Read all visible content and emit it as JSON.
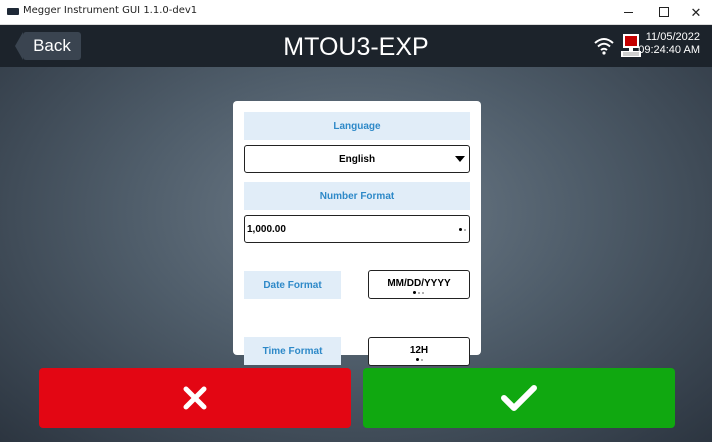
{
  "window": {
    "title": "Megger Instrument GUI 1.1.0-dev1",
    "controls": [
      "minimize",
      "maximize",
      "close"
    ]
  },
  "header": {
    "back_label": "Back",
    "title": "MTOU3-EXP",
    "date": "11/05/2022",
    "time": "09:24:40 AM",
    "icons": [
      "wifi-icon",
      "device-status-icon"
    ]
  },
  "settings": {
    "language_label": "Language",
    "language_value": "English",
    "number_format_label": "Number Format",
    "number_format_value": "1,000.00",
    "date_format_label": "Date Format",
    "date_format_value": "MM/DD/YYYY",
    "time_format_label": "Time Format",
    "time_format_value": "12H"
  },
  "actions": {
    "cancel_icon": "close-icon",
    "confirm_icon": "check-icon"
  },
  "colors": {
    "accent_label": "#2e89c8",
    "cancel": "#e30613",
    "confirm": "#10a810",
    "header": "#1c232b"
  }
}
